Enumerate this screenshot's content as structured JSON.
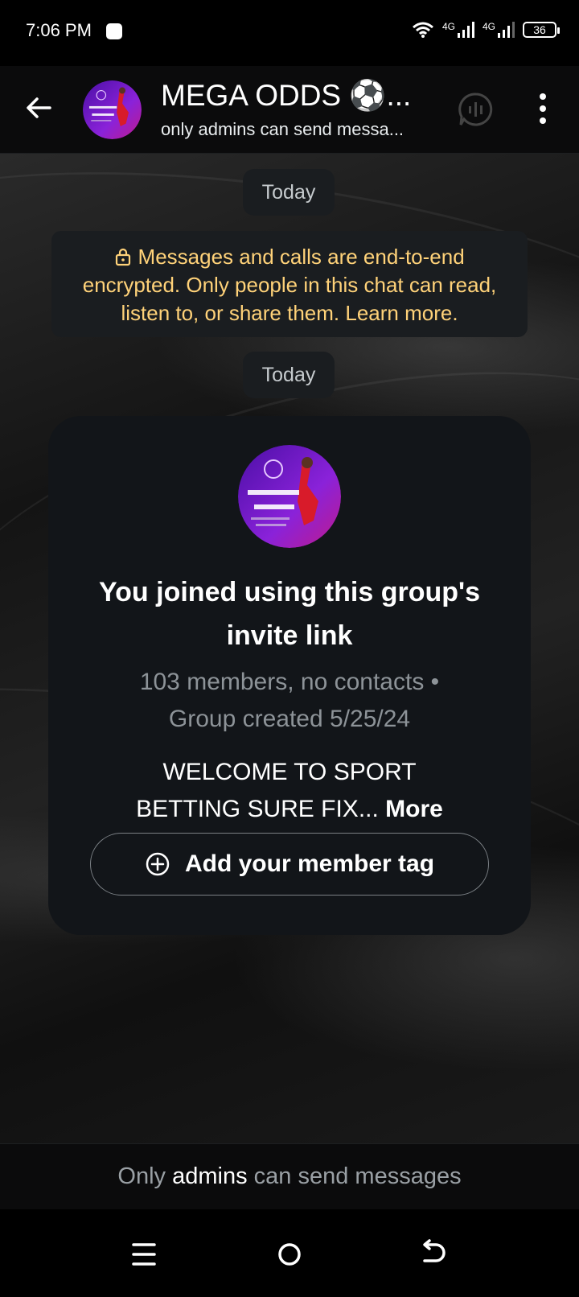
{
  "status_bar": {
    "time": "7:06 PM",
    "signal_1_label": "4G",
    "signal_2_label": "4G",
    "battery_level": "36",
    "icons": [
      "notification-square-icon",
      "wifi-icon",
      "signal-icon",
      "signal-icon",
      "battery-icon"
    ]
  },
  "header": {
    "title": "MEGA ODDS ⚽...",
    "subtitle": "only admins can send messa...",
    "avatar_text_1": "PROGRAMMED GAMES",
    "avatar_text_2": "AVAILABLE NOW",
    "icons": [
      "back-arrow-icon",
      "voice-chat-icon",
      "more-vert-icon"
    ]
  },
  "chat": {
    "date_pill_1": "Today",
    "encryption_notice": "Messages and calls are end-to-end encrypted. Only people in this chat can read, listen to, or share them. Learn more.",
    "date_pill_2": "Today"
  },
  "group_card": {
    "avatar_text_1": "PROGRAMMED GAMES",
    "avatar_text_2": "AVAILABLE NOW",
    "title": "You joined using this group's invite link",
    "meta_line_1": "103 members, no contacts •",
    "meta_line_2": "Group created 5/25/24",
    "description_line_1": "WELCOME TO SPORT",
    "description_line_2": "BETTING SURE FIX...",
    "more_label": "More",
    "member_tag_button": "Add your member tag"
  },
  "footer": {
    "prefix": "Only",
    "highlight": "admins",
    "suffix": "can send messages"
  },
  "colors": {
    "background": "#0b0b0c",
    "encryption_text": "#ffd279",
    "card_background": "#121519",
    "muted_text": "#8d9398",
    "avatar_purple": "#7a1fd1"
  }
}
